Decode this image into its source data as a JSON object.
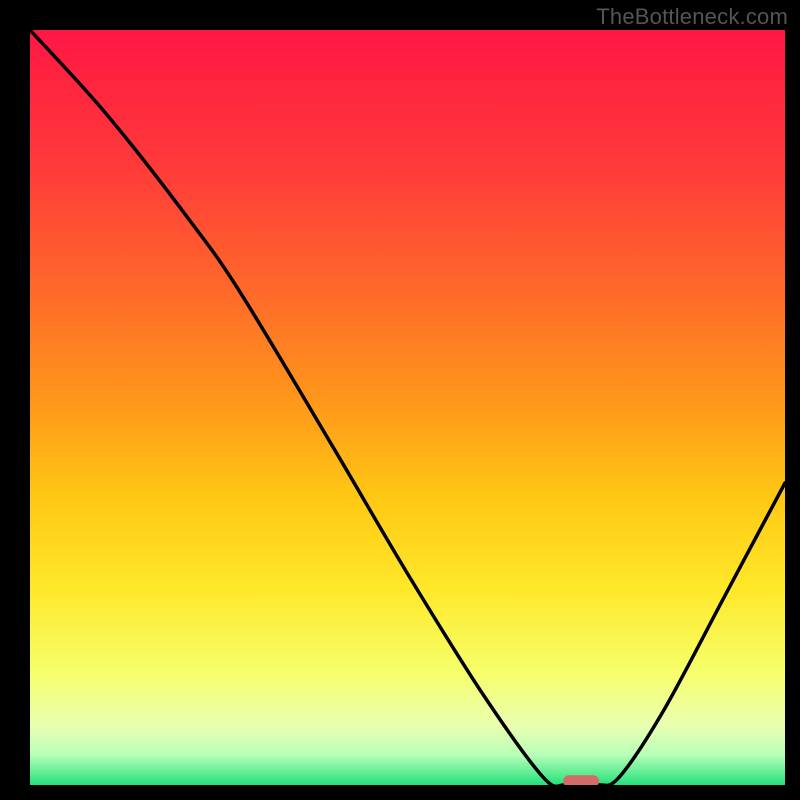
{
  "watermark": "TheBottleneck.com",
  "chart_data": {
    "type": "line",
    "title": "",
    "xlabel": "",
    "ylabel": "",
    "xlim": [
      0,
      100
    ],
    "ylim": [
      0,
      100
    ],
    "series": [
      {
        "name": "curve",
        "x": [
          0,
          10,
          21,
          28,
          40,
          50,
          60,
          68,
          71,
          75,
          78,
          84,
          92,
          100
        ],
        "values": [
          100,
          89,
          75,
          65,
          45,
          28,
          12,
          1,
          0,
          0,
          1,
          10,
          25,
          40
        ]
      }
    ],
    "marker": {
      "x": 73,
      "y": 0.5
    },
    "gradient_stops": [
      {
        "pct": 0,
        "color": "#ff1744"
      },
      {
        "pct": 18,
        "color": "#ff3a3a"
      },
      {
        "pct": 35,
        "color": "#ff6a2a"
      },
      {
        "pct": 50,
        "color": "#ff9a1a"
      },
      {
        "pct": 62,
        "color": "#ffc814"
      },
      {
        "pct": 74,
        "color": "#ffe82a"
      },
      {
        "pct": 85,
        "color": "#f6ff6a"
      },
      {
        "pct": 92,
        "color": "#eaffb0"
      },
      {
        "pct": 96,
        "color": "#b8ffb8"
      },
      {
        "pct": 100,
        "color": "#24e07a"
      }
    ]
  }
}
